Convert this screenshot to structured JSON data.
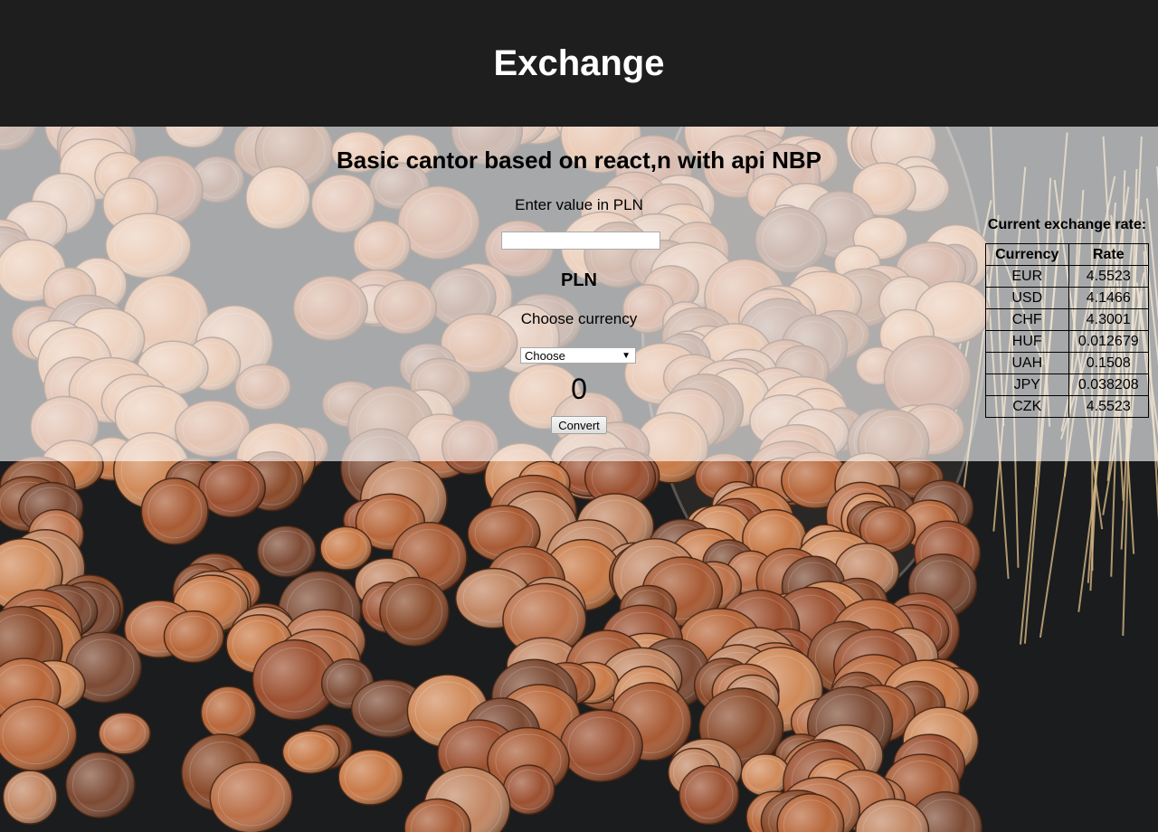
{
  "header": {
    "title": "Exchange"
  },
  "converter": {
    "heading": "Basic cantor based on react,n with api NBP",
    "enter_label": "Enter value in PLN",
    "input_value": "",
    "input_placeholder": "",
    "base_currency": "PLN",
    "choose_label": "Choose currency",
    "select_value": "Choose",
    "result": "0",
    "convert_label": "Convert"
  },
  "rates": {
    "title": "Current exchange rate:",
    "headers": [
      "Currency",
      "Rate"
    ],
    "rows": [
      {
        "currency": "EUR",
        "rate": "4.5523"
      },
      {
        "currency": "USD",
        "rate": "4.1466"
      },
      {
        "currency": "CHF",
        "rate": "4.3001"
      },
      {
        "currency": "HUF",
        "rate": "0.012679"
      },
      {
        "currency": "UAH",
        "rate": "0.1508"
      },
      {
        "currency": "JPY",
        "rate": "0.038208"
      },
      {
        "currency": "CZK",
        "rate": "4.5523"
      }
    ]
  },
  "colors": {
    "header_bg": "#1e1e1e",
    "header_text": "#ffffff",
    "overlay": "rgba(255,255,255,0.62)",
    "coin_copper": "#b8673a"
  },
  "icons": {
    "select_caret": "chevron-down-icon"
  }
}
